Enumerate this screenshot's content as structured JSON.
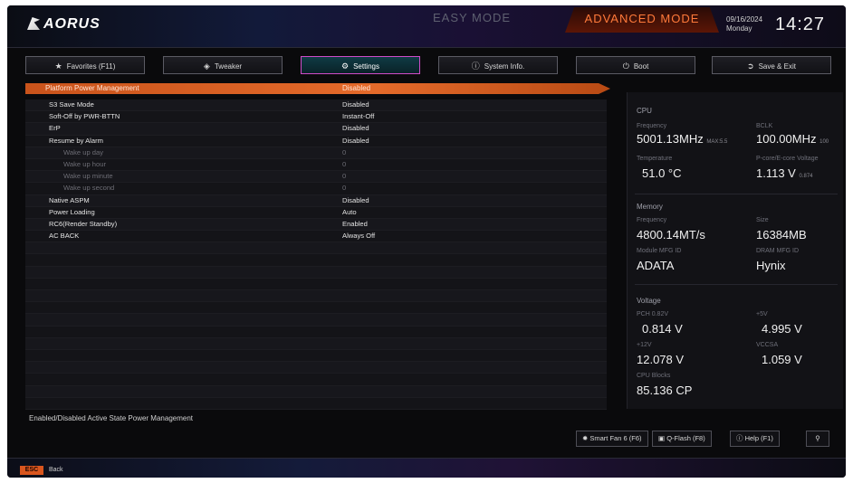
{
  "header": {
    "logo_text": "AORUS",
    "easy_mode": "EASY MODE",
    "advanced_mode": "ADVANCED MODE",
    "date": "09/16/2024",
    "weekday": "Monday",
    "time": "14:27"
  },
  "tabs": [
    {
      "label": "Favorites (F11)",
      "icon": "star-icon"
    },
    {
      "label": "Tweaker",
      "icon": "tweaker-icon"
    },
    {
      "label": "Settings",
      "icon": "gear-icon"
    },
    {
      "label": "System Info.",
      "icon": "info-icon"
    },
    {
      "label": "Boot",
      "icon": "power-icon"
    },
    {
      "label": "Save & Exit",
      "icon": "exit-icon"
    }
  ],
  "settings": {
    "section_label": "Platform Power Management",
    "section_value": "Disabled",
    "rows": [
      {
        "label": "S3 Save Mode",
        "value": "Disabled",
        "sub": false
      },
      {
        "label": "Soft-Off by PWR-BTTN",
        "value": "Instant-Off",
        "sub": false
      },
      {
        "label": "ErP",
        "value": "Disabled",
        "sub": false
      },
      {
        "label": "Resume by Alarm",
        "value": "Disabled",
        "sub": false
      },
      {
        "label": "Wake up day",
        "value": "0",
        "sub": true
      },
      {
        "label": "Wake up hour",
        "value": "0",
        "sub": true
      },
      {
        "label": "Wake up minute",
        "value": "0",
        "sub": true
      },
      {
        "label": "Wake up second",
        "value": "0",
        "sub": true
      },
      {
        "label": "Native ASPM",
        "value": "Disabled",
        "sub": false
      },
      {
        "label": "Power Loading",
        "value": "Auto",
        "sub": false
      },
      {
        "label": "RC6(Render Standby)",
        "value": "Enabled",
        "sub": false
      },
      {
        "label": "AC BACK",
        "value": "Always Off",
        "sub": false
      },
      {
        "label": "",
        "value": "",
        "sub": false
      },
      {
        "label": "",
        "value": "",
        "sub": false
      },
      {
        "label": "",
        "value": "",
        "sub": false
      },
      {
        "label": "",
        "value": "",
        "sub": false
      },
      {
        "label": "",
        "value": "",
        "sub": false
      },
      {
        "label": "",
        "value": "",
        "sub": false
      },
      {
        "label": "",
        "value": "",
        "sub": false
      },
      {
        "label": "",
        "value": "",
        "sub": false
      },
      {
        "label": "",
        "value": "",
        "sub": false
      },
      {
        "label": "",
        "value": "",
        "sub": false
      },
      {
        "label": "",
        "value": "",
        "sub": false
      },
      {
        "label": "",
        "value": "",
        "sub": false
      },
      {
        "label": "",
        "value": "",
        "sub": false
      },
      {
        "label": "",
        "value": "",
        "sub": false
      }
    ],
    "help_text": "Enabled/Disabled Active State Power Management"
  },
  "info": {
    "cpu": {
      "title": "CPU",
      "frequency_label": "Frequency",
      "frequency": "5001.13MHz",
      "frequency_sub": "MAX:5.5",
      "bclk_label": "BCLK",
      "bclk": "100.00MHz",
      "bclk_sub": "100",
      "temp_label": "Temperature",
      "temp": "51.0 °C",
      "vcore_label": "P-core/E-core Voltage",
      "vcore": "1.113 V",
      "vcore_sub": "0.874"
    },
    "memory": {
      "title": "Memory",
      "frequency_label": "Frequency",
      "frequency": "4800.14MT/s",
      "size_label": "Size",
      "size": "16384MB",
      "module_label": "Module MFG ID",
      "module": "ADATA",
      "dram_label": "DRAM MFG ID",
      "dram": "Hynix"
    },
    "voltage": {
      "title": "Voltage",
      "pch_label": "PCH 0.82V",
      "pch": "0.814 V",
      "v5_label": "+5V",
      "v5": "4.995 V",
      "v12_label": "+12V",
      "v12": "12.078 V",
      "vccsa_label": "VCCSA",
      "vccsa": "1.059 V",
      "cpu_blocks_label": "CPU Blocks",
      "cpu_blocks": "85.136 CP"
    }
  },
  "bottom": {
    "smart_fan": "Smart Fan 6 (F6)",
    "qflash": "Q-Flash (F8)",
    "help": "Help (F1)",
    "search_icon": "search-icon"
  },
  "footer": {
    "esc_key": "ESC",
    "back_label": "Back"
  }
}
